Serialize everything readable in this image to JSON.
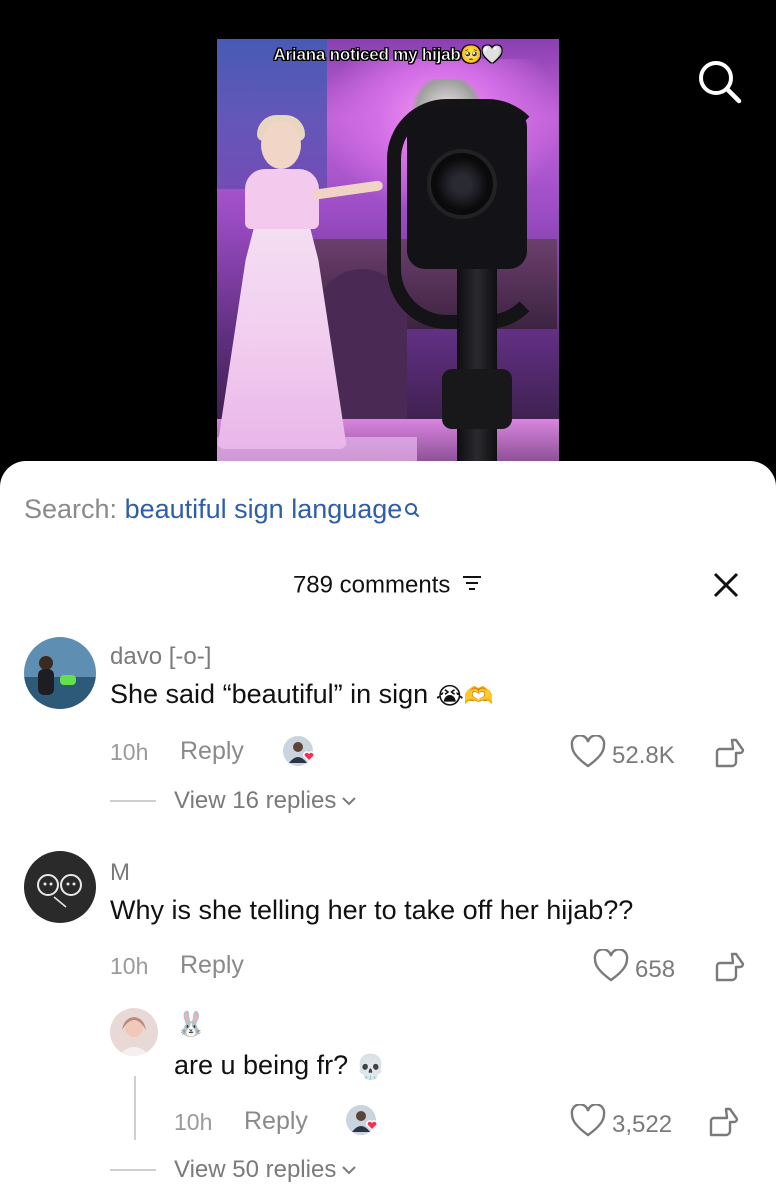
{
  "video": {
    "caption": "Ariana noticed my hijab🥺🤍"
  },
  "search": {
    "prefix": "Search:",
    "query": "beautiful sign language"
  },
  "comments_header": {
    "count_label": "789 comments"
  },
  "comments": [
    {
      "username": "davo [-o-]",
      "text": "She said “beautiful” in sign",
      "emojis": "😭🫶",
      "time": "10h",
      "reply_label": "Reply",
      "likes": "52.8K",
      "view_replies": "View 16 replies"
    },
    {
      "username": "M",
      "text": "Why is she telling her to take off her hijab??",
      "time": "10h",
      "reply_label": "Reply",
      "likes": "658"
    }
  ],
  "reply": {
    "username": "🐰",
    "text": "are u being fr?",
    "emoji": "💀",
    "time": "10h",
    "reply_label": "Reply",
    "likes": "3,522",
    "view_replies": "View 50 replies"
  },
  "colors": {
    "accent_link": "#2f5ea8",
    "liked_heart": "#ff2d55",
    "muted_text": "#7a7a7a"
  }
}
